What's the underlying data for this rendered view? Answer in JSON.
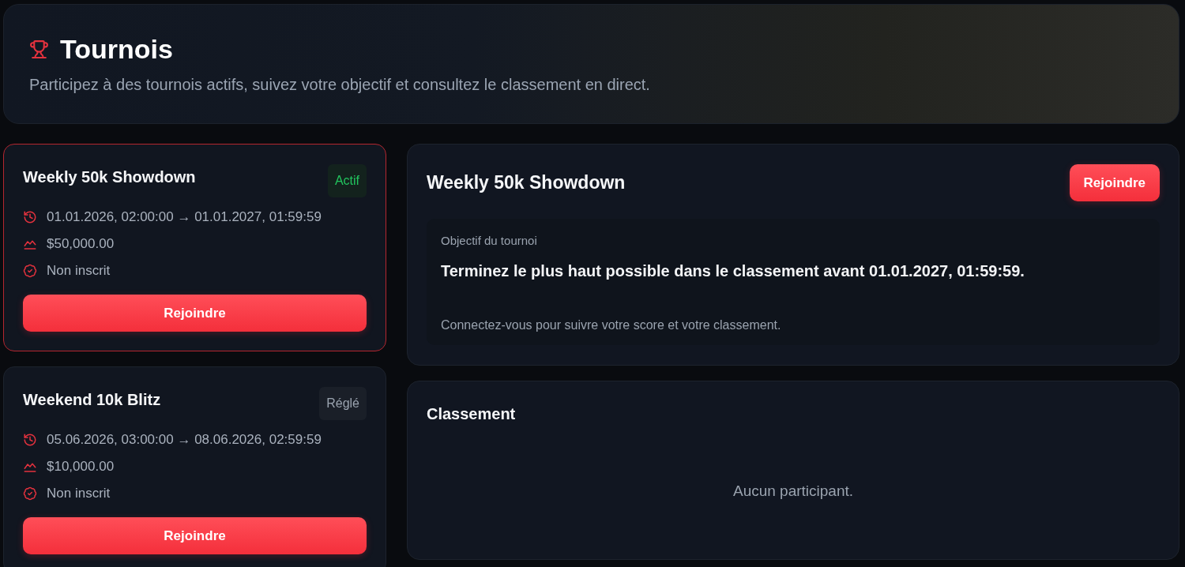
{
  "header": {
    "title": "Tournois",
    "subtitle": "Participez à des tournois actifs, suivez votre objectif et consultez le classement en direct."
  },
  "tournaments": [
    {
      "name": "Weekly 50k Showdown",
      "selected": true,
      "status": {
        "label": "Actif",
        "kind": "active"
      },
      "period": "01.01.2026, 02:00:00 → 01.01.2027, 01:59:59",
      "prize": "$50,000.00",
      "registration": "Non inscrit",
      "action": "Rejoindre"
    },
    {
      "name": "Weekend 10k Blitz",
      "selected": false,
      "status": {
        "label": "Réglé",
        "kind": "settled"
      },
      "period": "05.06.2026, 03:00:00 → 08.06.2026, 02:59:59",
      "prize": "$10,000.00",
      "registration": "Non inscrit",
      "action": "Rejoindre"
    }
  ],
  "detail": {
    "title": "Weekly 50k Showdown",
    "action": "Rejoindre",
    "objective": {
      "label": "Objectif du tournoi",
      "text": "Terminez le plus haut possible dans le classement avant 01.01.2027, 01:59:59."
    },
    "note": "Connectez-vous pour suivre votre score et votre classement."
  },
  "leaderboard": {
    "title": "Classement",
    "empty_message": "Aucun participant."
  }
}
